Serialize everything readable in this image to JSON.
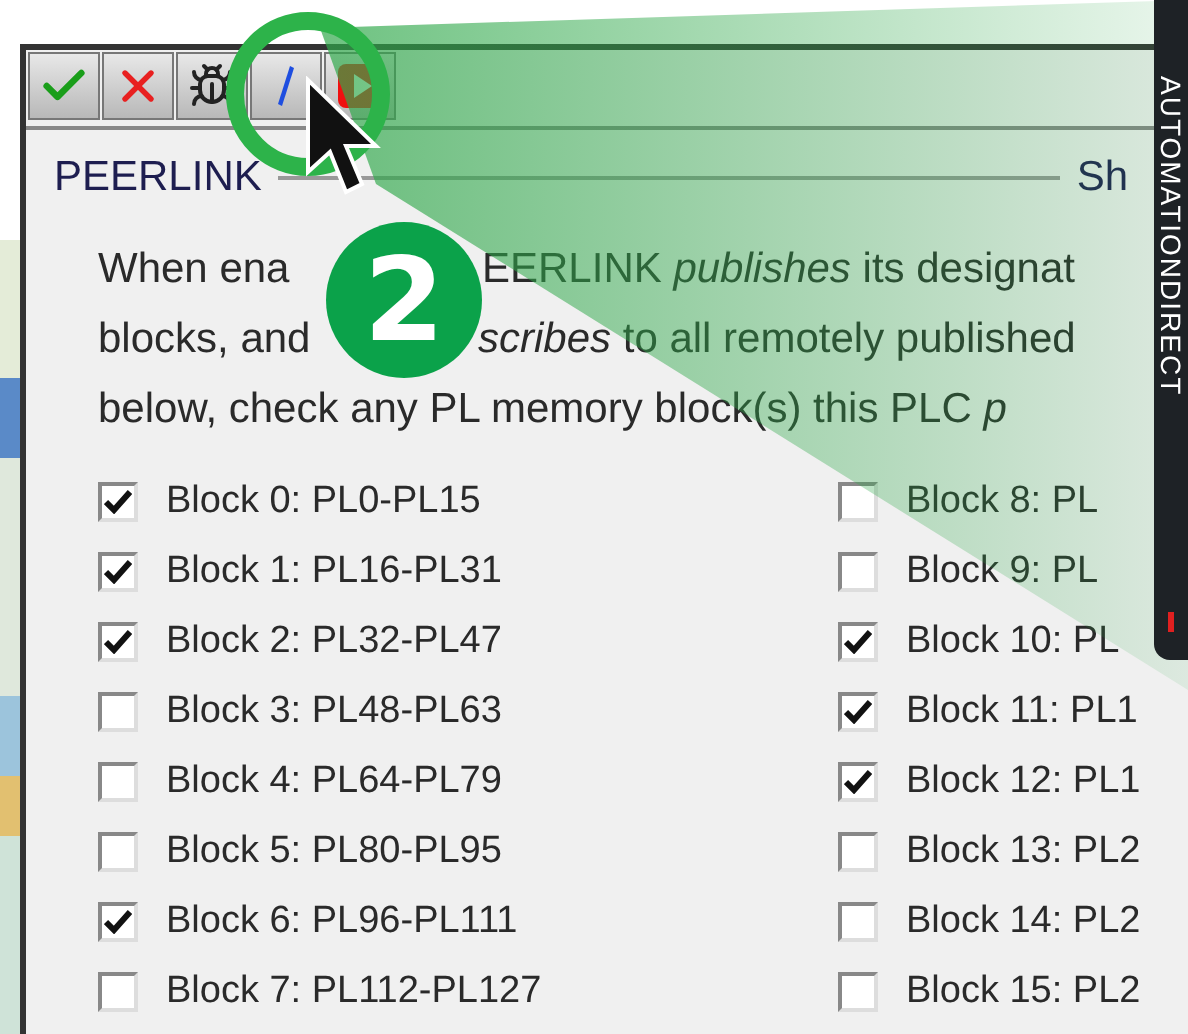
{
  "callout": {
    "number": "2"
  },
  "brand_strip": {
    "text": "AUTOMATIONDIRECT"
  },
  "group": {
    "title": "PEERLINK",
    "right_label": "Sh"
  },
  "description": {
    "lines": [
      [
        "When ena",
        "EERLINK *publishes* its designat"
      ],
      [
        "blocks, and",
        "*scribes* to all remotely published"
      ],
      [
        "below, check any PL memory block(s) this PLC *p*"
      ]
    ]
  },
  "blocks": [
    {
      "label": "Block 0: PL0-PL15",
      "checked": true
    },
    {
      "label": "Block 1: PL16-PL31",
      "checked": true
    },
    {
      "label": "Block 2: PL32-PL47",
      "checked": true
    },
    {
      "label": "Block 3: PL48-PL63",
      "checked": false
    },
    {
      "label": "Block 4: PL64-PL79",
      "checked": false
    },
    {
      "label": "Block 5: PL80-PL95",
      "checked": false
    },
    {
      "label": "Block 6: PL96-PL111",
      "checked": true
    },
    {
      "label": "Block 7: PL112-PL127",
      "checked": false
    },
    {
      "label": "Block 8: PL",
      "checked": false
    },
    {
      "label": "Block 9: PL",
      "checked": false
    },
    {
      "label": "Block 10: PL",
      "checked": true
    },
    {
      "label": "Block 11: PL1",
      "checked": true
    },
    {
      "label": "Block 12: PL1",
      "checked": true
    },
    {
      "label": "Block 13: PL2",
      "checked": false
    },
    {
      "label": "Block 14: PL2",
      "checked": false
    },
    {
      "label": "Block 15: PL2",
      "checked": false
    }
  ]
}
